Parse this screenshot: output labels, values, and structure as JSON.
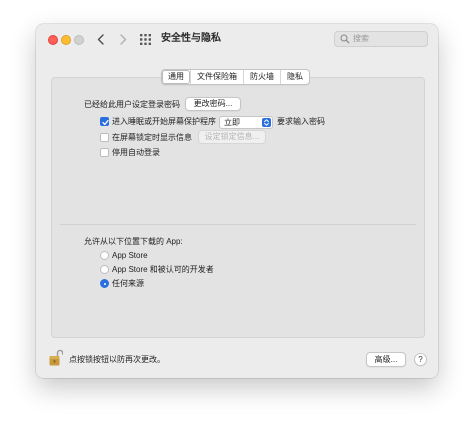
{
  "window": {
    "title": "安全性与隐私",
    "search_placeholder": "搜索"
  },
  "tabs": [
    {
      "label": "通用",
      "selected": true
    },
    {
      "label": "文件保险箱",
      "selected": false
    },
    {
      "label": "防火墙",
      "selected": false
    },
    {
      "label": "隐私",
      "selected": false
    }
  ],
  "general": {
    "password_set_label": "已经给此用户设定登录密码",
    "change_password_button": "更改密码...",
    "require_password": {
      "checked": true,
      "label_prefix": "进入睡眠或开始屏幕保护程序",
      "select_value": "立即",
      "label_suffix": "要求输入密码"
    },
    "lock_screen_message": {
      "checked": false,
      "label": "在屏幕锁定时显示信息",
      "button": "设定锁定信息..."
    },
    "disable_auto_login": {
      "checked": false,
      "label": "停用自动登录"
    }
  },
  "downloads": {
    "heading": "允许从以下位置下载的 App:",
    "options": [
      {
        "label": "App Store",
        "selected": false
      },
      {
        "label": "App Store 和被认可的开发者",
        "selected": false
      },
      {
        "label": "任何来源",
        "selected": true
      }
    ]
  },
  "footer": {
    "lock_text": "点按锁按钮以防再次更改。",
    "advanced_button": "高级...",
    "help_button": "?"
  },
  "colors": {
    "accent": "#2b6fdf",
    "window_bg": "#ececec",
    "panel_bg": "#e3e3e3",
    "lock_gold": "#c99a3c"
  },
  "icons": [
    "back-chevron-icon",
    "forward-chevron-icon",
    "grid-icon",
    "search-icon",
    "checkmark-icon",
    "select-arrows-icon",
    "unlocked-padlock-icon"
  ]
}
